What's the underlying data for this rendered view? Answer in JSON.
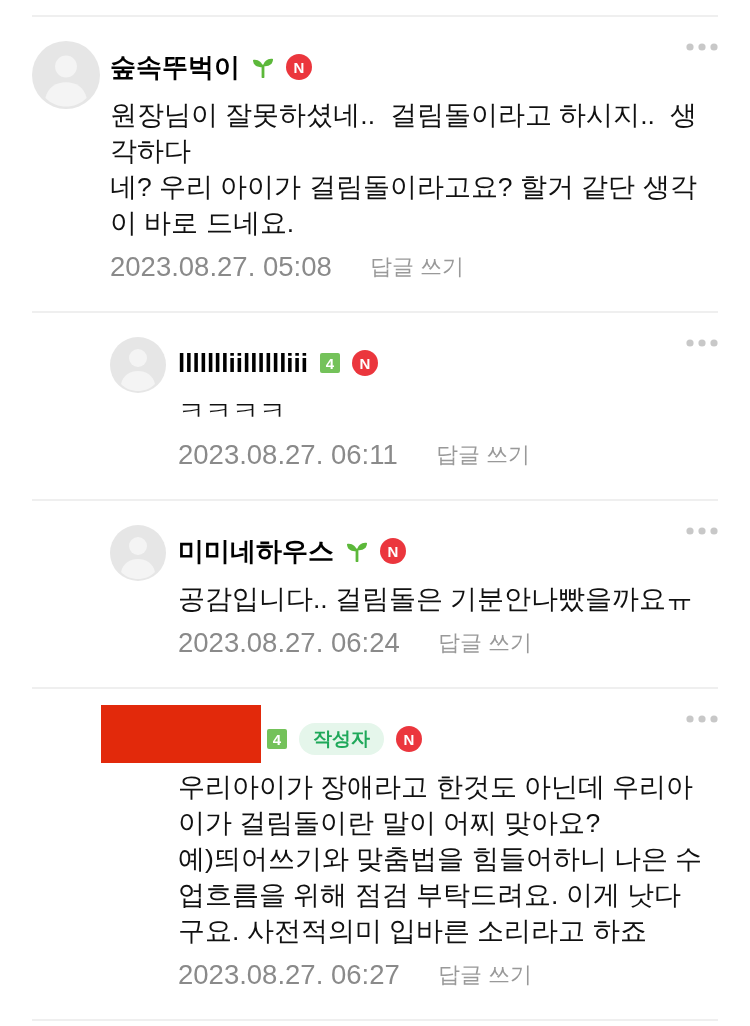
{
  "comments": [
    {
      "redacted": false,
      "author": "숲속뚜벅이",
      "grade": {
        "kind": "sprout"
      },
      "new_badge": "N",
      "text": "원장님이 잘못하셨네..  걸림돌이라고 하시지..  생\n각하다\n네? 우리 아이가 걸림돌이라고요? 할거 같단 생각\n이 바로 드네요.",
      "date": "2023.08.27. 05:08",
      "reply_action": "답글 쓰기",
      "children": [
        {
          "redacted": false,
          "author": "llllllliilllllliii",
          "grade": {
            "kind": "level",
            "label": "4"
          },
          "new_badge": "N",
          "text": "ㅋㅋㅋㅋ",
          "date": "2023.08.27. 06:11",
          "reply_action": "답글 쓰기"
        },
        {
          "redacted": false,
          "author": "미미네하우스",
          "grade": {
            "kind": "sprout"
          },
          "new_badge": "N",
          "text": "공감입니다.. 걸림돌은 기분안나빴을까요ㅠ",
          "date": "2023.08.27. 06:24",
          "reply_action": "답글 쓰기"
        },
        {
          "redacted": true,
          "grade": {
            "kind": "level",
            "label": "4"
          },
          "author_tag": "작성자",
          "new_badge": "N",
          "text": "우리아이가 장애라고 한것도 아닌데 우리아\n이가 걸림돌이란 말이 어찌 맞아요?\n예)띄어쓰기와 맞춤법을 힘들어하니 나은 수\n업흐름을 위해 점검 부탁드려요. 이게 낫다\n구요. 사전적의미 입바른 소리라고 하죠",
          "date": "2023.08.27. 06:27",
          "reply_action": "답글 쓰기"
        }
      ]
    }
  ]
}
